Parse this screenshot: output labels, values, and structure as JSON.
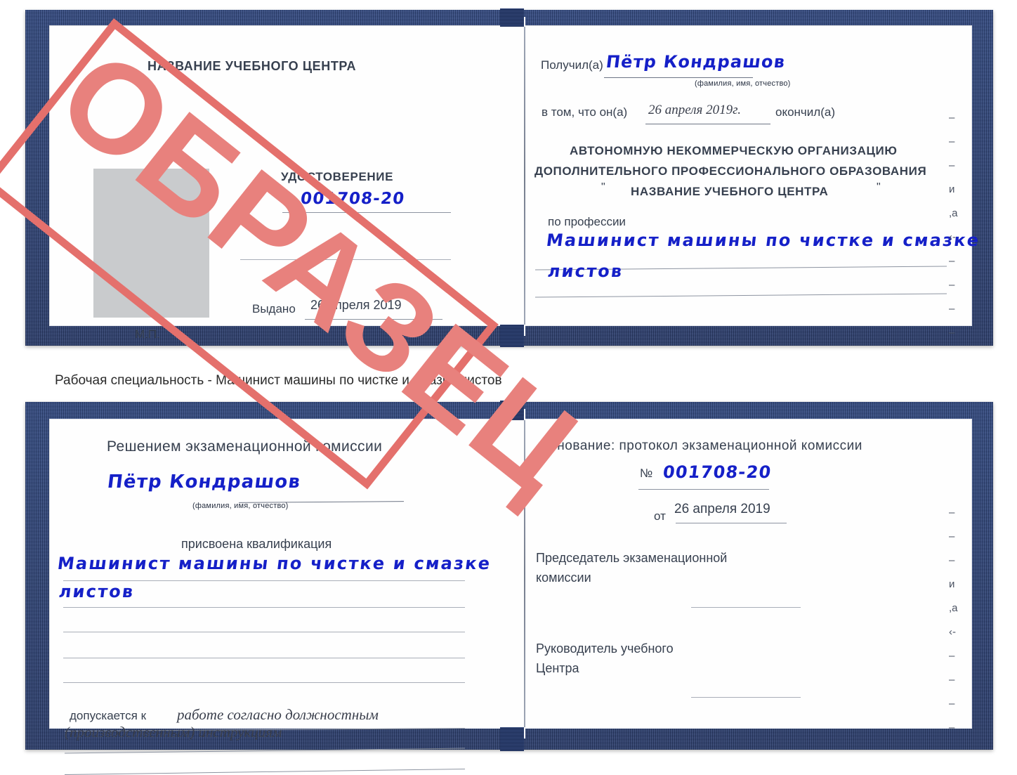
{
  "caption": "Рабочая специальность - Машинист машины по чистке и смазке листов",
  "colors": {
    "cover_blue": "#27417e",
    "stamp_red": "#e4706c",
    "ink_blue": "#1520c8",
    "rule_gray": "#8d94a1",
    "photo_gray": "#c9cbcd"
  },
  "watermark": {
    "text": "ОБРАЗЕЦ"
  },
  "certificate1": {
    "left_page": {
      "center_name": "НАЗВАНИЕ УЧЕБНОГО ЦЕНТРА",
      "doc_title": "УДОСТОВЕРЕНИЕ",
      "number_label": "№",
      "number_value": "001708-20",
      "issued_label": "Выдано",
      "issued_date": "26 апреля 2019",
      "seal_label": "М.П."
    },
    "right_page": {
      "received_label": "Получил(а)",
      "received_name": "Пётр Кондрашов",
      "name_hint": "(фамилия, имя, отчество)",
      "in_that_label": "в том, что он(а)",
      "completion_date": "26 апреля 2019г.",
      "finished_label": "окончил(а)",
      "org_line1": "АВТОНОМНУЮ НЕКОММЕРЧЕСКУЮ ОРГАНИЗАЦИЮ",
      "org_line2": "ДОПОЛНИТЕЛЬНОГО ПРОФЕССИОНАЛЬНОГО ОБРАЗОВАНИЯ",
      "org_quote_open": "\"",
      "org_line3": "НАЗВАНИЕ УЧЕБНОГО ЦЕНТРА",
      "org_quote_close": "\"",
      "profession_label": "по профессии",
      "profession_value_line1": "Машинист машины по чистке и смазке",
      "profession_value_line2": "листов",
      "edge_marks": [
        "–",
        "–",
        "–",
        "и",
        ",а",
        "‹-",
        "–",
        "–",
        "–",
        "–"
      ]
    }
  },
  "certificate2": {
    "left_page": {
      "heading": "Решением экзаменационной комиссии",
      "name": "Пётр Кондрашов",
      "name_hint": "(фамилия, имя, отчество)",
      "qualification_label": "присвоена квалификация",
      "qualification_line1": "Машинист машины по чистке и смазке",
      "qualification_line2": "листов",
      "admitted_label": "допускается к",
      "admitted_value_line1": "работе согласно должностным",
      "admitted_value_line2": "(производственным) инструкциям"
    },
    "right_page": {
      "basis_label": "Основание: протокол экзаменационной комиссии",
      "number_label": "№",
      "number_value": "001708-20",
      "date_label": "от",
      "date_value": "26 апреля 2019",
      "chairman_line1": "Председатель экзаменационной",
      "chairman_line2": "комиссии",
      "head_line1": "Руководитель учебного",
      "head_line2": "Центра",
      "edge_marks": [
        "–",
        "–",
        "–",
        "и",
        ",а",
        "‹-",
        "–",
        "–",
        "–",
        "–"
      ]
    }
  }
}
